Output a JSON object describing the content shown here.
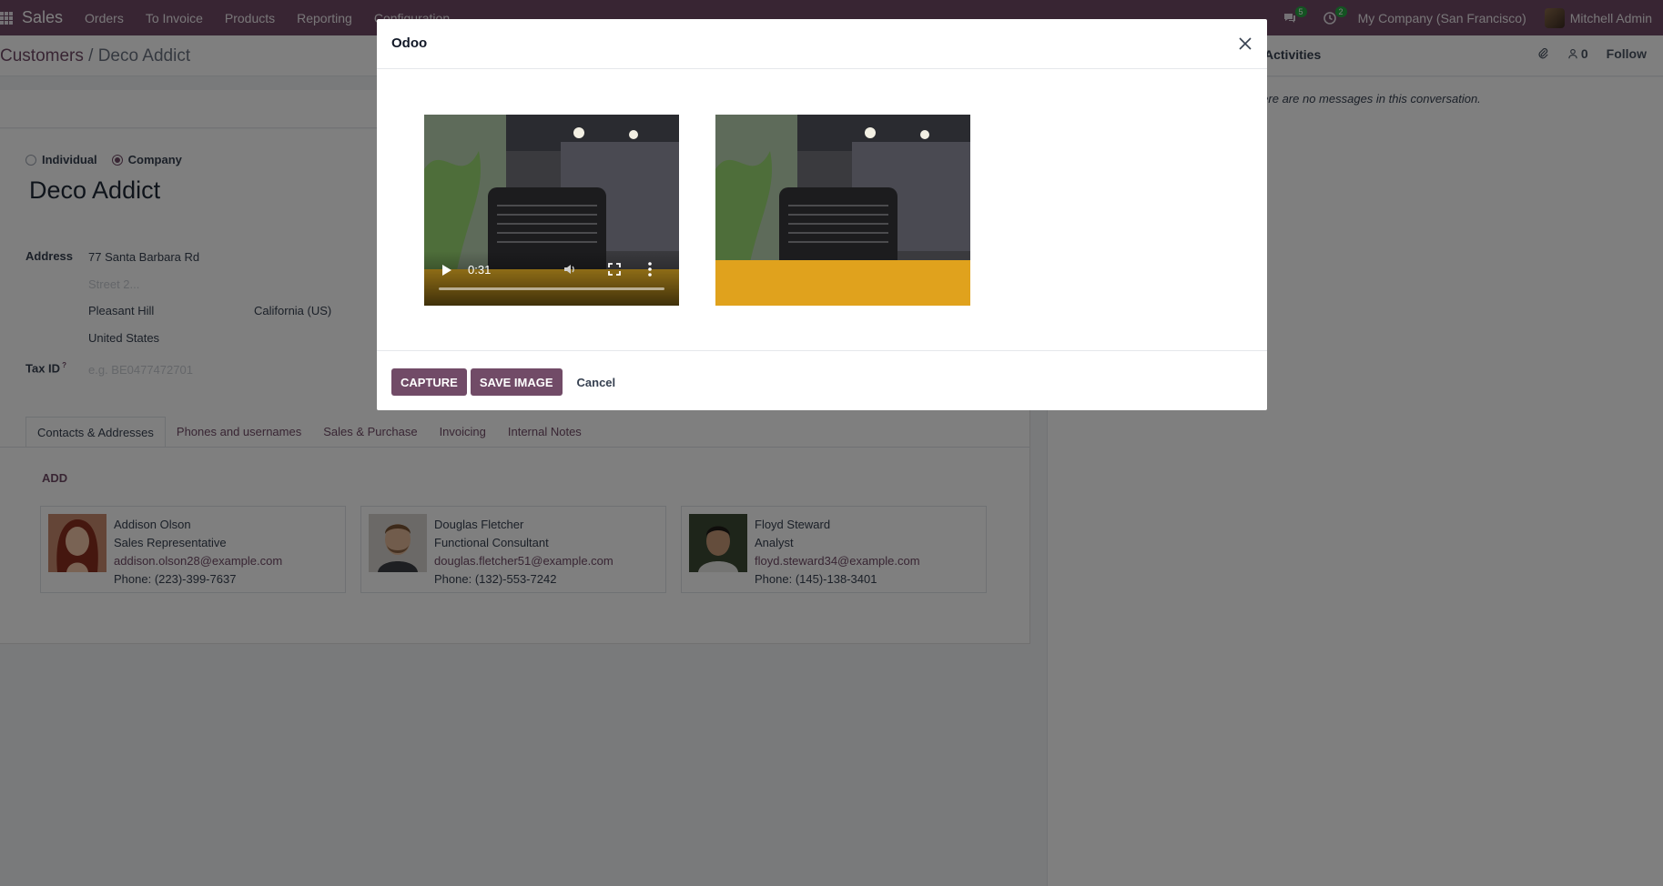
{
  "navbar": {
    "app_name": "Sales",
    "menu": [
      "Orders",
      "To Invoice",
      "Products",
      "Reporting",
      "Configuration"
    ],
    "messages_count": "5",
    "activities_count": "2",
    "company": "My Company (San Francisco)",
    "user": "Mitchell Admin"
  },
  "breadcrumb": {
    "parent": "Customers",
    "separator": "/",
    "current": "Deco Addict"
  },
  "chatter": {
    "activities_label": "Activities",
    "followers_count": "0",
    "follow_label": "Follow",
    "empty_message": "There are no messages in this conversation."
  },
  "form": {
    "type_individual": "Individual",
    "type_company": "Company",
    "name": "Deco Addict",
    "address_label": "Address",
    "street": "77 Santa Barbara Rd",
    "street2_placeholder": "Street 2...",
    "city": "Pleasant Hill",
    "state": "California (US)",
    "country": "United States",
    "tax_label": "Tax ID",
    "tax_help": "?",
    "tax_placeholder": "e.g. BE0477472701"
  },
  "tabs": [
    "Contacts & Addresses",
    "Phones and usernames",
    "Sales & Purchase",
    "Invoicing",
    "Internal Notes"
  ],
  "add_label": "ADD",
  "contacts": [
    {
      "name": "Addison Olson",
      "role": "Sales Representative",
      "email": "addison.olson28@example.com",
      "phone": "Phone: (223)-399-7637"
    },
    {
      "name": "Douglas Fletcher",
      "role": "Functional Consultant",
      "email": "douglas.fletcher51@example.com",
      "phone": "Phone: (132)-553-7242"
    },
    {
      "name": "Floyd Steward",
      "role": "Analyst",
      "email": "floyd.steward34@example.com",
      "phone": "Phone: (145)-138-3401"
    }
  ],
  "modal": {
    "title": "Odoo",
    "video_time": "0:31",
    "capture_label": "CAPTURE",
    "save_label": "SAVE IMAGE",
    "cancel_label": "Cancel"
  },
  "colors": {
    "brand": "#714b67",
    "badge": "#28a745"
  }
}
